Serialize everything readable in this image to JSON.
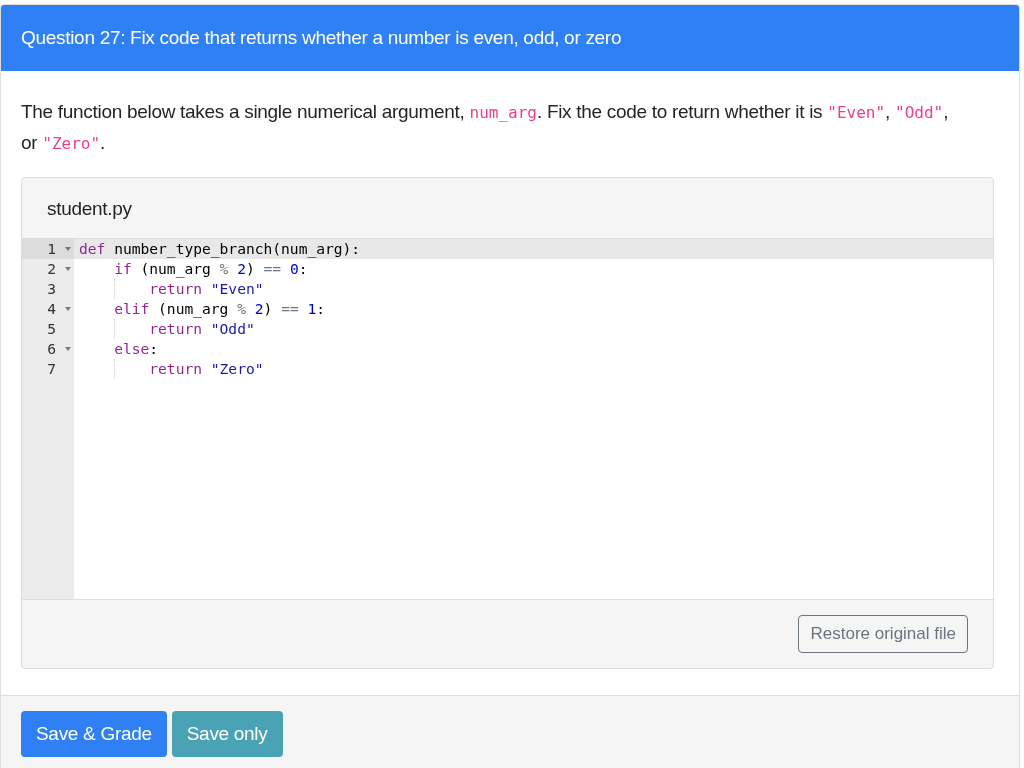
{
  "question": {
    "title": "Question 27: Fix code that returns whether a number is even, odd, or zero"
  },
  "description": [
    {
      "kind": "text",
      "text": "The function below takes a single numerical argument, "
    },
    {
      "kind": "code",
      "text": "num_arg"
    },
    {
      "kind": "text",
      "text": ". Fix the code to return whether it is "
    },
    {
      "kind": "code",
      "text": "\"Even\""
    },
    {
      "kind": "text",
      "text": ", "
    },
    {
      "kind": "code",
      "text": "\"Odd\""
    },
    {
      "kind": "text",
      "text": ", or "
    },
    {
      "kind": "code",
      "text": "\"Zero\""
    },
    {
      "kind": "text",
      "text": "."
    }
  ],
  "file": {
    "name": "student.py",
    "lines": [
      {
        "number": "1",
        "foldable": true,
        "active": true,
        "tokens": [
          {
            "kind": "keyword",
            "text": "def"
          },
          {
            "kind": "plain",
            "text": " number_type_branch(num_arg):"
          }
        ]
      },
      {
        "number": "2",
        "foldable": true,
        "active": false,
        "tokens": [
          {
            "kind": "keyword",
            "text": "    if"
          },
          {
            "kind": "plain",
            "text": " (num_arg "
          },
          {
            "kind": "operator",
            "text": "%"
          },
          {
            "kind": "number",
            "text": " 2"
          },
          {
            "kind": "plain",
            "text": ") "
          },
          {
            "kind": "operator",
            "text": "=="
          },
          {
            "kind": "number",
            "text": " 0"
          },
          {
            "kind": "plain",
            "text": ":"
          }
        ]
      },
      {
        "number": "3",
        "foldable": false,
        "active": false,
        "tokens": [
          {
            "kind": "keyword",
            "text": "        return"
          },
          {
            "kind": "string",
            "text": " \"Even\""
          }
        ]
      },
      {
        "number": "4",
        "foldable": true,
        "active": false,
        "tokens": [
          {
            "kind": "keyword",
            "text": "    elif"
          },
          {
            "kind": "plain",
            "text": " (num_arg "
          },
          {
            "kind": "operator",
            "text": "%"
          },
          {
            "kind": "number",
            "text": " 2"
          },
          {
            "kind": "plain",
            "text": ") "
          },
          {
            "kind": "operator",
            "text": "=="
          },
          {
            "kind": "number",
            "text": " 1"
          },
          {
            "kind": "plain",
            "text": ":"
          }
        ]
      },
      {
        "number": "5",
        "foldable": false,
        "active": false,
        "tokens": [
          {
            "kind": "keyword",
            "text": "        return"
          },
          {
            "kind": "string",
            "text": " \"Odd\""
          }
        ]
      },
      {
        "number": "6",
        "foldable": true,
        "active": false,
        "tokens": [
          {
            "kind": "keyword",
            "text": "    else"
          },
          {
            "kind": "plain",
            "text": ":"
          }
        ]
      },
      {
        "number": "7",
        "foldable": false,
        "active": false,
        "tokens": [
          {
            "kind": "keyword",
            "text": "        return"
          },
          {
            "kind": "string",
            "text": " \"Zero\""
          }
        ]
      }
    ],
    "restore_button": "Restore original file"
  },
  "buttons": [
    {
      "kind": "primary",
      "label": "Save & Grade"
    },
    {
      "kind": "info",
      "label": "Save only"
    }
  ]
}
